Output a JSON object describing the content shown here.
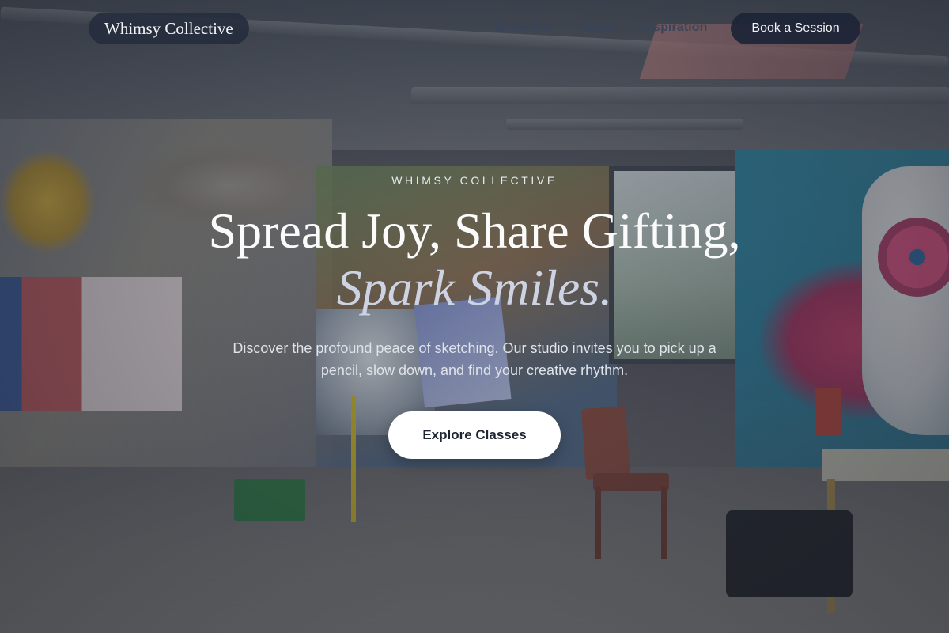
{
  "nav": {
    "brand": "Whimsy Collective",
    "links": [
      "Expertise",
      "About",
      "Inspiration"
    ],
    "cta": "Book a Session"
  },
  "hero": {
    "eyebrow": "WHIMSY COLLECTIVE",
    "headline_line1": "Spread Joy, Share Gifting,",
    "headline_line2": "Spark Smiles.",
    "subtext": "Discover the profound peace of sketching. Our studio invites you to pick up a pencil, slow down, and find your creative rhythm.",
    "cta": "Explore Classes"
  },
  "background": {
    "description_icon": "graffiti-art-studio-photo"
  },
  "colors": {
    "nav_pill": "#242c3e",
    "nav_link": "#39445a",
    "cta_primary": "#ffffff",
    "headline_accent": "#cdd3e2"
  }
}
